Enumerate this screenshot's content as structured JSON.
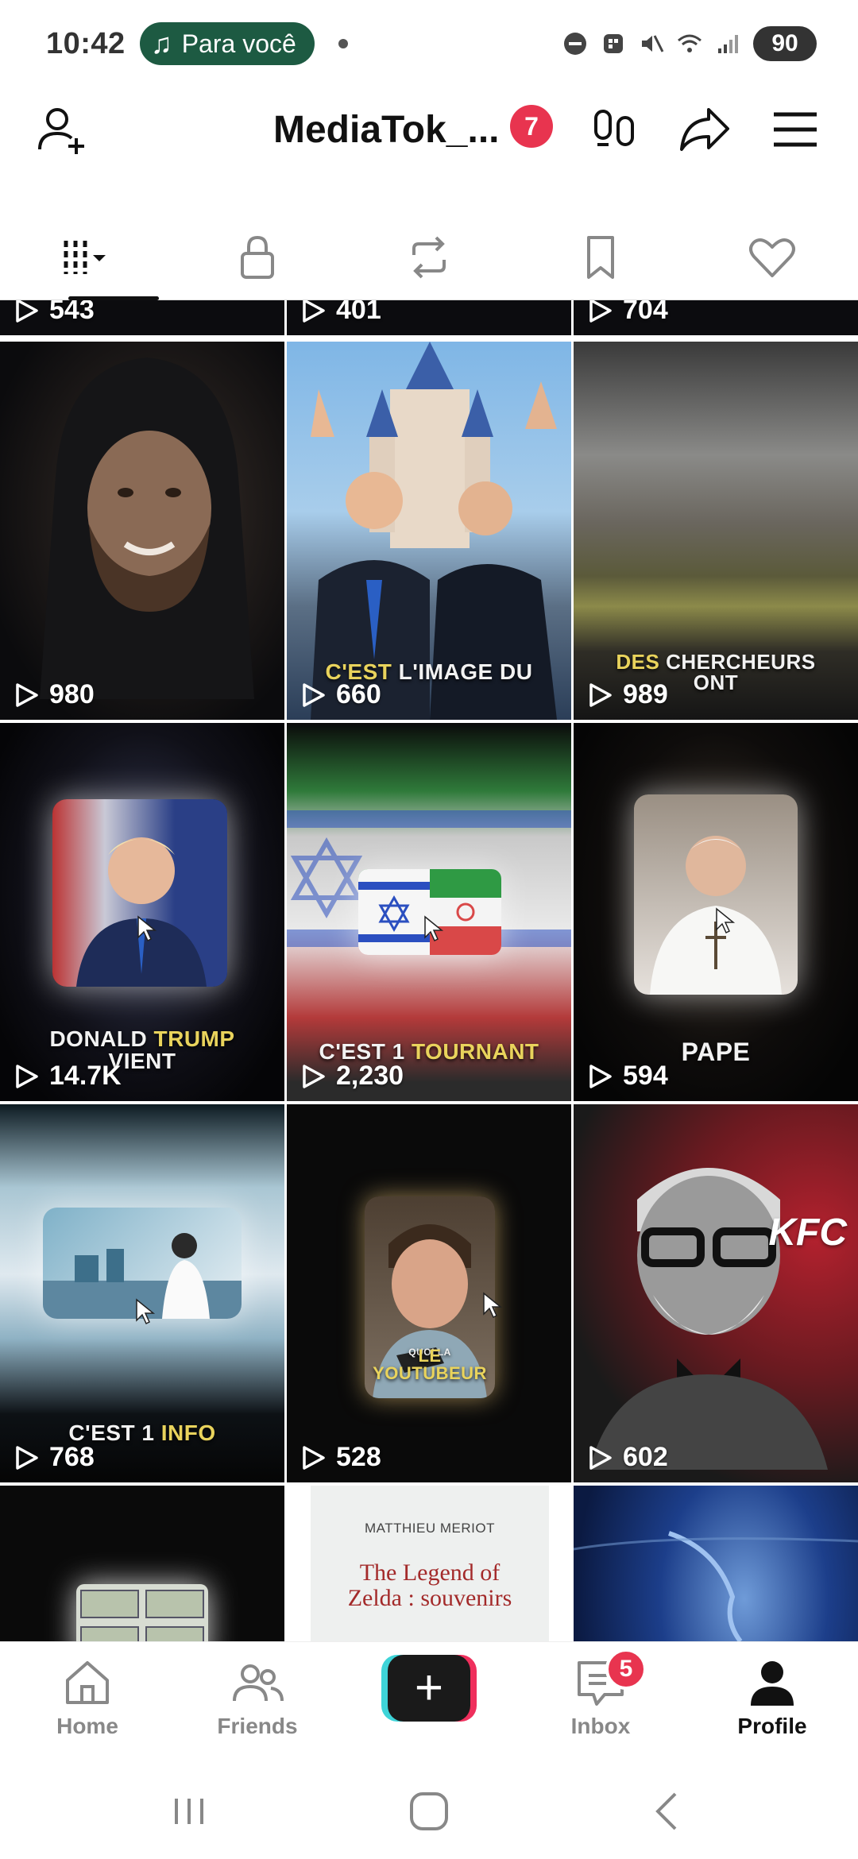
{
  "status_bar": {
    "time": "10:42",
    "media_pill": "Para você",
    "battery": "90"
  },
  "header": {
    "profile_name": "MediaTok_...",
    "notification_count": "7"
  },
  "tabs": [
    {
      "icon": "grid-icon",
      "active": true
    },
    {
      "icon": "lock-icon",
      "active": false
    },
    {
      "icon": "repost-icon",
      "active": false
    },
    {
      "icon": "bookmark-icon",
      "active": false
    },
    {
      "icon": "heart-icon",
      "active": false
    }
  ],
  "videos": [
    {
      "views": "543",
      "overlay": ""
    },
    {
      "views": "401",
      "overlay": ""
    },
    {
      "views": "704",
      "overlay": ""
    },
    {
      "views": "980",
      "overlay": ""
    },
    {
      "views": "660",
      "overlay_hl": "C'EST",
      "overlay": "L'IMAGE DU"
    },
    {
      "views": "989",
      "overlay_hl": "DES",
      "overlay": "CHERCHEURS",
      "overlay2": "ONT"
    },
    {
      "views": "14.7K",
      "overlay": "DONALD",
      "overlay_hl": "TRUMP",
      "overlay2": "VIENT"
    },
    {
      "views": "2,230",
      "overlay": "C'EST 1",
      "overlay_hl": "TOURNANT"
    },
    {
      "views": "594",
      "overlay": "PAPE"
    },
    {
      "views": "768",
      "overlay": "C'EST 1",
      "overlay_hl": "INFO"
    },
    {
      "views": "528",
      "overlay_small": "QUOI LA",
      "overlay_hl": "LE YOUTUBEUR"
    },
    {
      "views": "602",
      "logo_text": "KFC"
    },
    {
      "views": "",
      "overlay": ""
    },
    {
      "views": "",
      "book_author": "MATTHIEU MERIOT",
      "book_title_1": "The Legend of",
      "book_title_2": "Zelda : souvenirs"
    },
    {
      "views": "",
      "overlay": ""
    }
  ],
  "bottom_nav": {
    "home": "Home",
    "friends": "Friends",
    "inbox": "Inbox",
    "inbox_badge": "5",
    "profile": "Profile",
    "create": "+"
  }
}
